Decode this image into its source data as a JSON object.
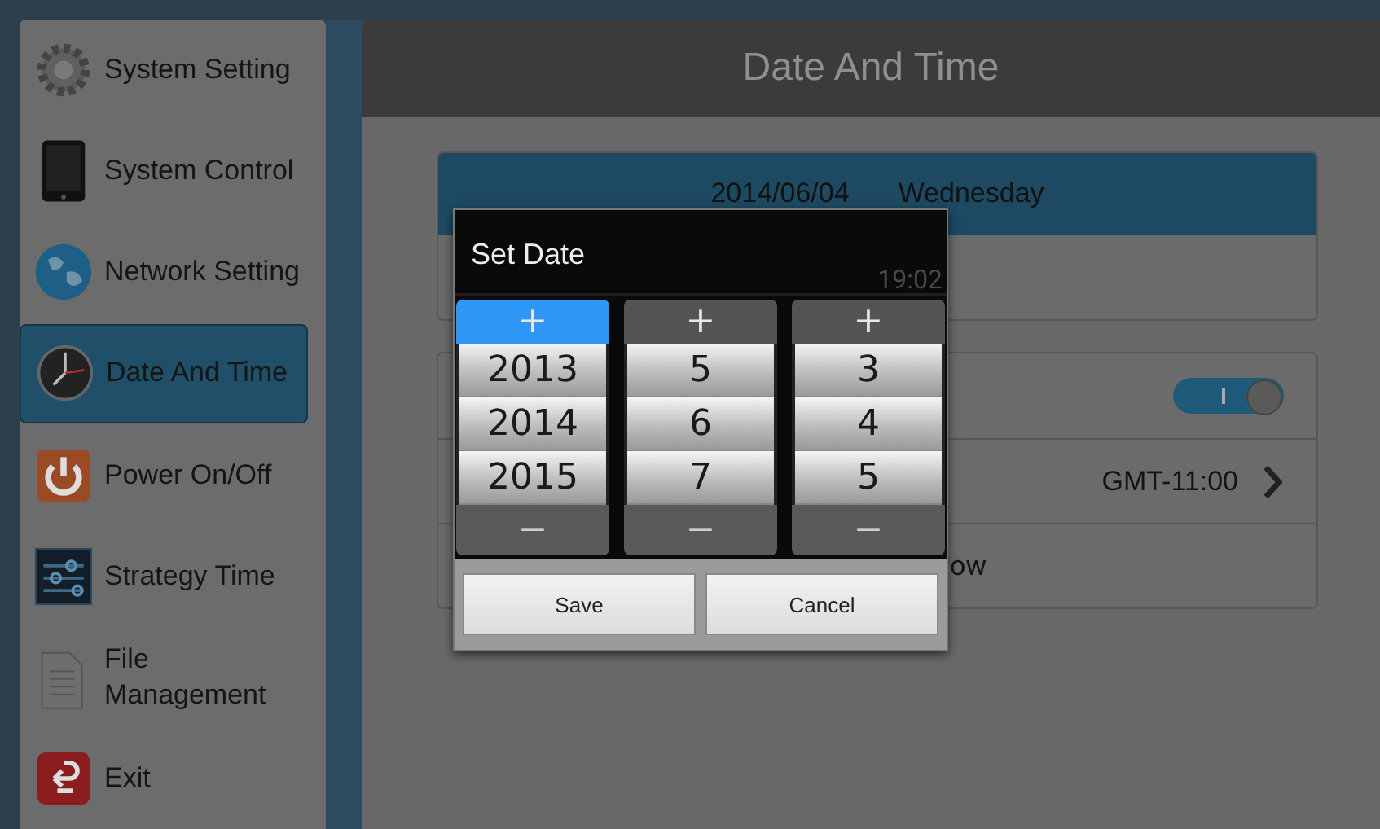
{
  "sidebar": {
    "items": [
      {
        "label": "System Setting",
        "selected": false
      },
      {
        "label": "System Control",
        "selected": false
      },
      {
        "label": "Network Setting",
        "selected": false
      },
      {
        "label": "Date And Time",
        "selected": true
      },
      {
        "label": "Power On/Off",
        "selected": false
      },
      {
        "label": "Strategy Time",
        "selected": false
      },
      {
        "label": "File\nManagement",
        "selected": false
      },
      {
        "label": "Exit",
        "selected": false
      }
    ]
  },
  "header": {
    "title": "Date And Time"
  },
  "date_card": {
    "date": "2014/06/04",
    "weekday": "Wednesday",
    "time": "19:02"
  },
  "settings": [
    {
      "kind": "toggle",
      "on": true
    },
    {
      "kind": "value",
      "value": "GMT-11:00"
    },
    {
      "kind": "label",
      "label": "ow"
    }
  ],
  "dialog": {
    "title": "Set Date",
    "columns": [
      {
        "plus": "+",
        "focused": true,
        "values": [
          "2013",
          "2014",
          "2015"
        ],
        "minus": "−"
      },
      {
        "plus": "+",
        "focused": false,
        "values": [
          "5",
          "6",
          "7"
        ],
        "minus": "−"
      },
      {
        "plus": "+",
        "focused": false,
        "values": [
          "3",
          "4",
          "5"
        ],
        "minus": "−"
      }
    ],
    "buttons": [
      "Save",
      "Cancel"
    ]
  }
}
